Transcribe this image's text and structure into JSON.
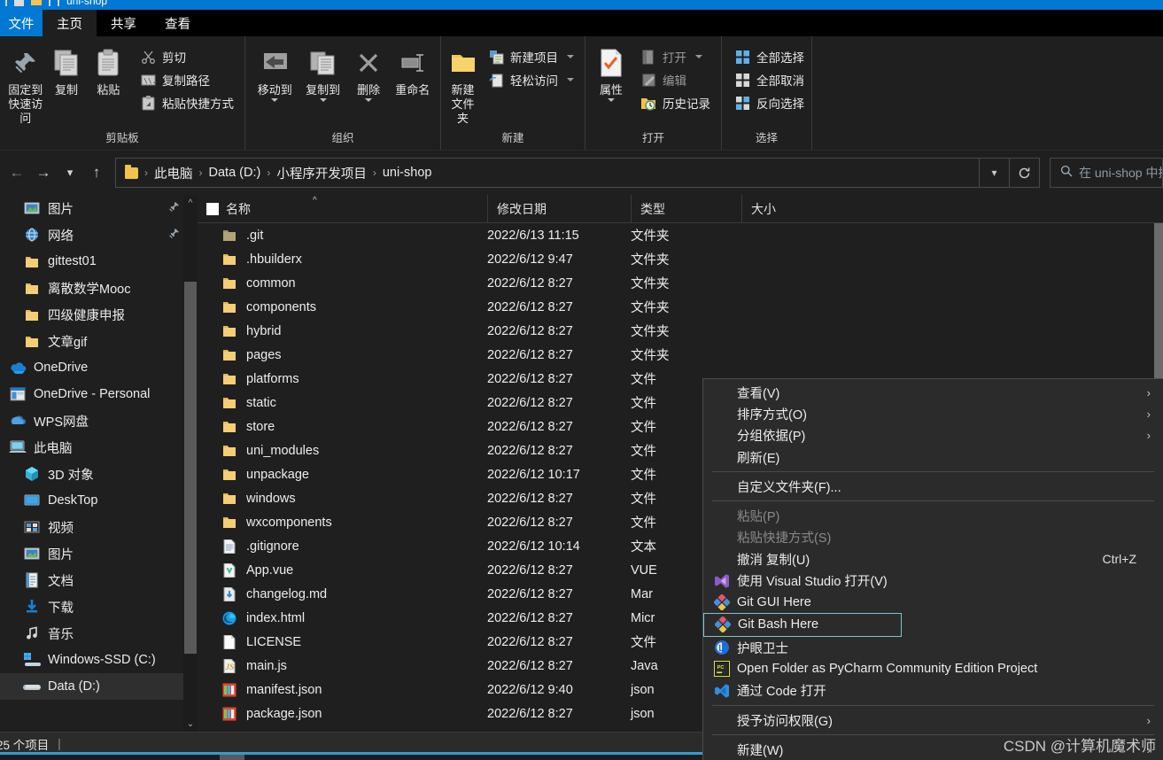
{
  "window": {
    "title": "uni-shop"
  },
  "tabs": [
    {
      "label": "文件",
      "key": "file"
    },
    {
      "label": "主页",
      "key": "home"
    },
    {
      "label": "共享",
      "key": "share"
    },
    {
      "label": "查看",
      "key": "view"
    }
  ],
  "ribbon": {
    "groups": [
      {
        "name": "剪贴板",
        "label": "剪贴板",
        "big": [
          {
            "label": "固定到\n快速访问",
            "line1": "固定到",
            "line2": "快速访问",
            "icon": "pin-icon"
          },
          {
            "label": "复制",
            "icon": "copy-icon"
          },
          {
            "label": "粘贴",
            "icon": "paste-icon"
          }
        ],
        "small": [
          {
            "label": "剪切",
            "icon": "scissors-icon"
          },
          {
            "label": "复制路径",
            "icon": "copy-path-icon"
          },
          {
            "label": "粘贴快捷方式",
            "icon": "paste-shortcut-icon"
          }
        ]
      },
      {
        "name": "组织",
        "label": "组织",
        "big": [
          {
            "label": "移动到",
            "icon": "move-to-icon",
            "caret": true
          },
          {
            "label": "复制到",
            "icon": "copy-to-icon",
            "caret": true
          },
          {
            "label": "删除",
            "icon": "delete-icon",
            "caret": true
          },
          {
            "label": "重命名",
            "icon": "rename-icon"
          }
        ]
      },
      {
        "name": "新建",
        "label": "新建",
        "big": [
          {
            "line1": "新建",
            "line2": "文件夹",
            "label": "新建文件夹",
            "icon": "new-folder-icon"
          }
        ],
        "small": [
          {
            "label": "新建项目",
            "icon": "new-item-icon",
            "caret": true
          },
          {
            "label": "轻松访问",
            "icon": "easy-access-icon",
            "caret": true
          }
        ]
      },
      {
        "name": "打开",
        "label": "打开",
        "big": [
          {
            "label": "属性",
            "icon": "properties-icon",
            "caret": true
          }
        ],
        "small": [
          {
            "label": "打开",
            "icon": "open-icon",
            "caret": true,
            "dim": true
          },
          {
            "label": "编辑",
            "icon": "edit-icon",
            "dim": true
          },
          {
            "label": "历史记录",
            "icon": "history-icon"
          }
        ]
      },
      {
        "name": "选择",
        "label": "选择",
        "small": [
          {
            "label": "全部选择",
            "icon": "select-all-icon"
          },
          {
            "label": "全部取消",
            "icon": "select-none-icon"
          },
          {
            "label": "反向选择",
            "icon": "invert-selection-icon"
          }
        ]
      }
    ]
  },
  "addressbar": {
    "back_icon": "arrow-left-icon",
    "forward_icon": "arrow-right-icon",
    "recent_icon": "chevron-down-icon",
    "up_icon": "arrow-up-icon",
    "breadcrumbs": [
      "此电脑",
      "Data (D:)",
      "小程序开发项目",
      "uni-shop"
    ],
    "dropdown_icon": "chevron-down-icon",
    "refresh_icon": "refresh-icon",
    "search_placeholder": "在 uni-shop 中搜索",
    "search_icon": "search-icon"
  },
  "sidebar": {
    "items": [
      {
        "label": "图片",
        "icon": "picture-icon",
        "indent": 1,
        "pinned": true
      },
      {
        "label": "网络",
        "icon": "network-icon",
        "indent": 1,
        "pinned": true
      },
      {
        "label": "gittest01",
        "icon": "folder-icon",
        "indent": 1
      },
      {
        "label": "离散数学Mooc",
        "icon": "folder-icon",
        "indent": 1
      },
      {
        "label": "四级健康申报",
        "icon": "folder-icon",
        "indent": 1
      },
      {
        "label": "文章gif",
        "icon": "folder-icon",
        "indent": 1
      },
      {
        "label": "OneDrive",
        "icon": "onedrive-icon",
        "indent": 0
      },
      {
        "label": "OneDrive - Personal",
        "icon": "onedrive-personal-icon",
        "indent": 0
      },
      {
        "label": "WPS网盘",
        "icon": "wps-cloud-icon",
        "indent": 0
      },
      {
        "label": "此电脑",
        "icon": "this-pc-icon",
        "indent": 0
      },
      {
        "label": "3D 对象",
        "icon": "3d-objects-icon",
        "indent": 1
      },
      {
        "label": "DeskTop",
        "icon": "desktop-icon",
        "indent": 1
      },
      {
        "label": "视频",
        "icon": "videos-icon",
        "indent": 1
      },
      {
        "label": "图片",
        "icon": "picture-icon",
        "indent": 1
      },
      {
        "label": "文档",
        "icon": "documents-icon",
        "indent": 1
      },
      {
        "label": "下载",
        "icon": "downloads-icon",
        "indent": 1
      },
      {
        "label": "音乐",
        "icon": "music-icon",
        "indent": 1
      },
      {
        "label": "Windows-SSD (C:)",
        "icon": "local-disk-icon",
        "indent": 1
      },
      {
        "label": "Data (D:)",
        "icon": "drive-icon",
        "indent": 1,
        "selected": true
      }
    ]
  },
  "filelist": {
    "columns": [
      {
        "label": "名称",
        "key": "name",
        "sorted": true
      },
      {
        "label": "修改日期",
        "key": "date"
      },
      {
        "label": "类型",
        "key": "type"
      },
      {
        "label": "大小",
        "key": "size"
      }
    ],
    "rows": [
      {
        "name": ".git",
        "date": "2022/6/13 11:15",
        "type": "文件夹",
        "size": "",
        "icon": "folder-dim-icon"
      },
      {
        "name": ".hbuilderx",
        "date": "2022/6/12 9:47",
        "type": "文件夹",
        "size": "",
        "icon": "folder-icon"
      },
      {
        "name": "common",
        "date": "2022/6/12 8:27",
        "type": "文件夹",
        "size": "",
        "icon": "folder-icon"
      },
      {
        "name": "components",
        "date": "2022/6/12 8:27",
        "type": "文件夹",
        "size": "",
        "icon": "folder-icon"
      },
      {
        "name": "hybrid",
        "date": "2022/6/12 8:27",
        "type": "文件夹",
        "size": "",
        "icon": "folder-icon"
      },
      {
        "name": "pages",
        "date": "2022/6/12 8:27",
        "type": "文件夹",
        "size": "",
        "icon": "folder-icon"
      },
      {
        "name": "platforms",
        "date": "2022/6/12 8:27",
        "type": "文件",
        "size": "",
        "icon": "folder-icon"
      },
      {
        "name": "static",
        "date": "2022/6/12 8:27",
        "type": "文件",
        "size": "",
        "icon": "folder-icon"
      },
      {
        "name": "store",
        "date": "2022/6/12 8:27",
        "type": "文件",
        "size": "",
        "icon": "folder-icon"
      },
      {
        "name": "uni_modules",
        "date": "2022/6/12 8:27",
        "type": "文件",
        "size": "",
        "icon": "folder-icon"
      },
      {
        "name": "unpackage",
        "date": "2022/6/12 10:17",
        "type": "文件",
        "size": "",
        "icon": "folder-icon"
      },
      {
        "name": "windows",
        "date": "2022/6/12 8:27",
        "type": "文件",
        "size": "",
        "icon": "folder-icon"
      },
      {
        "name": "wxcomponents",
        "date": "2022/6/12 8:27",
        "type": "文件",
        "size": "",
        "icon": "folder-icon"
      },
      {
        "name": ".gitignore",
        "date": "2022/6/12 10:14",
        "type": "文本",
        "size": "",
        "icon": "text-file-icon"
      },
      {
        "name": "App.vue",
        "date": "2022/6/12 8:27",
        "type": "VUE",
        "size": "",
        "icon": "vue-file-icon"
      },
      {
        "name": "changelog.md",
        "date": "2022/6/12 8:27",
        "type": "Mar",
        "size": "",
        "icon": "markdown-file-icon"
      },
      {
        "name": "index.html",
        "date": "2022/6/12 8:27",
        "type": "Micr",
        "size": "",
        "icon": "edge-file-icon"
      },
      {
        "name": "LICENSE",
        "date": "2022/6/12 8:27",
        "type": "文件",
        "size": "",
        "icon": "blank-file-icon"
      },
      {
        "name": "main.js",
        "date": "2022/6/12 8:27",
        "type": "Java",
        "size": "",
        "icon": "js-file-icon"
      },
      {
        "name": "manifest.json",
        "date": "2022/6/12 9:40",
        "type": "json",
        "size": "",
        "icon": "json-file-icon"
      },
      {
        "name": "package.json",
        "date": "2022/6/12 8:27",
        "type": "json",
        "size": "",
        "icon": "json-file-icon"
      }
    ]
  },
  "contextmenu": {
    "items": [
      {
        "label": "查看(V)",
        "submenu": true
      },
      {
        "label": "排序方式(O)",
        "submenu": true
      },
      {
        "label": "分组依据(P)",
        "submenu": true
      },
      {
        "label": "刷新(E)"
      },
      {
        "separator": true
      },
      {
        "label": "自定义文件夹(F)..."
      },
      {
        "separator": true
      },
      {
        "label": "粘贴(P)",
        "disabled": true
      },
      {
        "label": "粘贴快捷方式(S)",
        "disabled": true
      },
      {
        "label": "撤消 复制(U)",
        "accel": "Ctrl+Z"
      },
      {
        "label": "使用 Visual Studio 打开(V)",
        "icon": "visual-studio-icon"
      },
      {
        "label": "Git GUI Here",
        "icon": "git-icon"
      },
      {
        "label": "Git Bash Here",
        "icon": "git-icon",
        "highlighted": true
      },
      {
        "label": "护眼卫士",
        "icon": "eye-guard-icon"
      },
      {
        "label": "Open Folder as PyCharm Community Edition Project",
        "icon": "pycharm-icon"
      },
      {
        "label": "通过 Code 打开",
        "icon": "vscode-icon"
      },
      {
        "separator": true
      },
      {
        "label": "授予访问权限(G)",
        "submenu": true
      },
      {
        "separator": true
      },
      {
        "label": "新建(W)",
        "submenu": true
      }
    ]
  },
  "statusbar": {
    "count": "25 个项目",
    "separator": "|"
  },
  "watermark": {
    "text": "CSDN @计算机魔术师"
  },
  "colors": {
    "accent": "#0078d4",
    "folder": "#f2c14e",
    "menu_bg": "#2b2b2b",
    "highlight_border": "#7fc4cf",
    "panel_bg": "#1f1f1f"
  }
}
